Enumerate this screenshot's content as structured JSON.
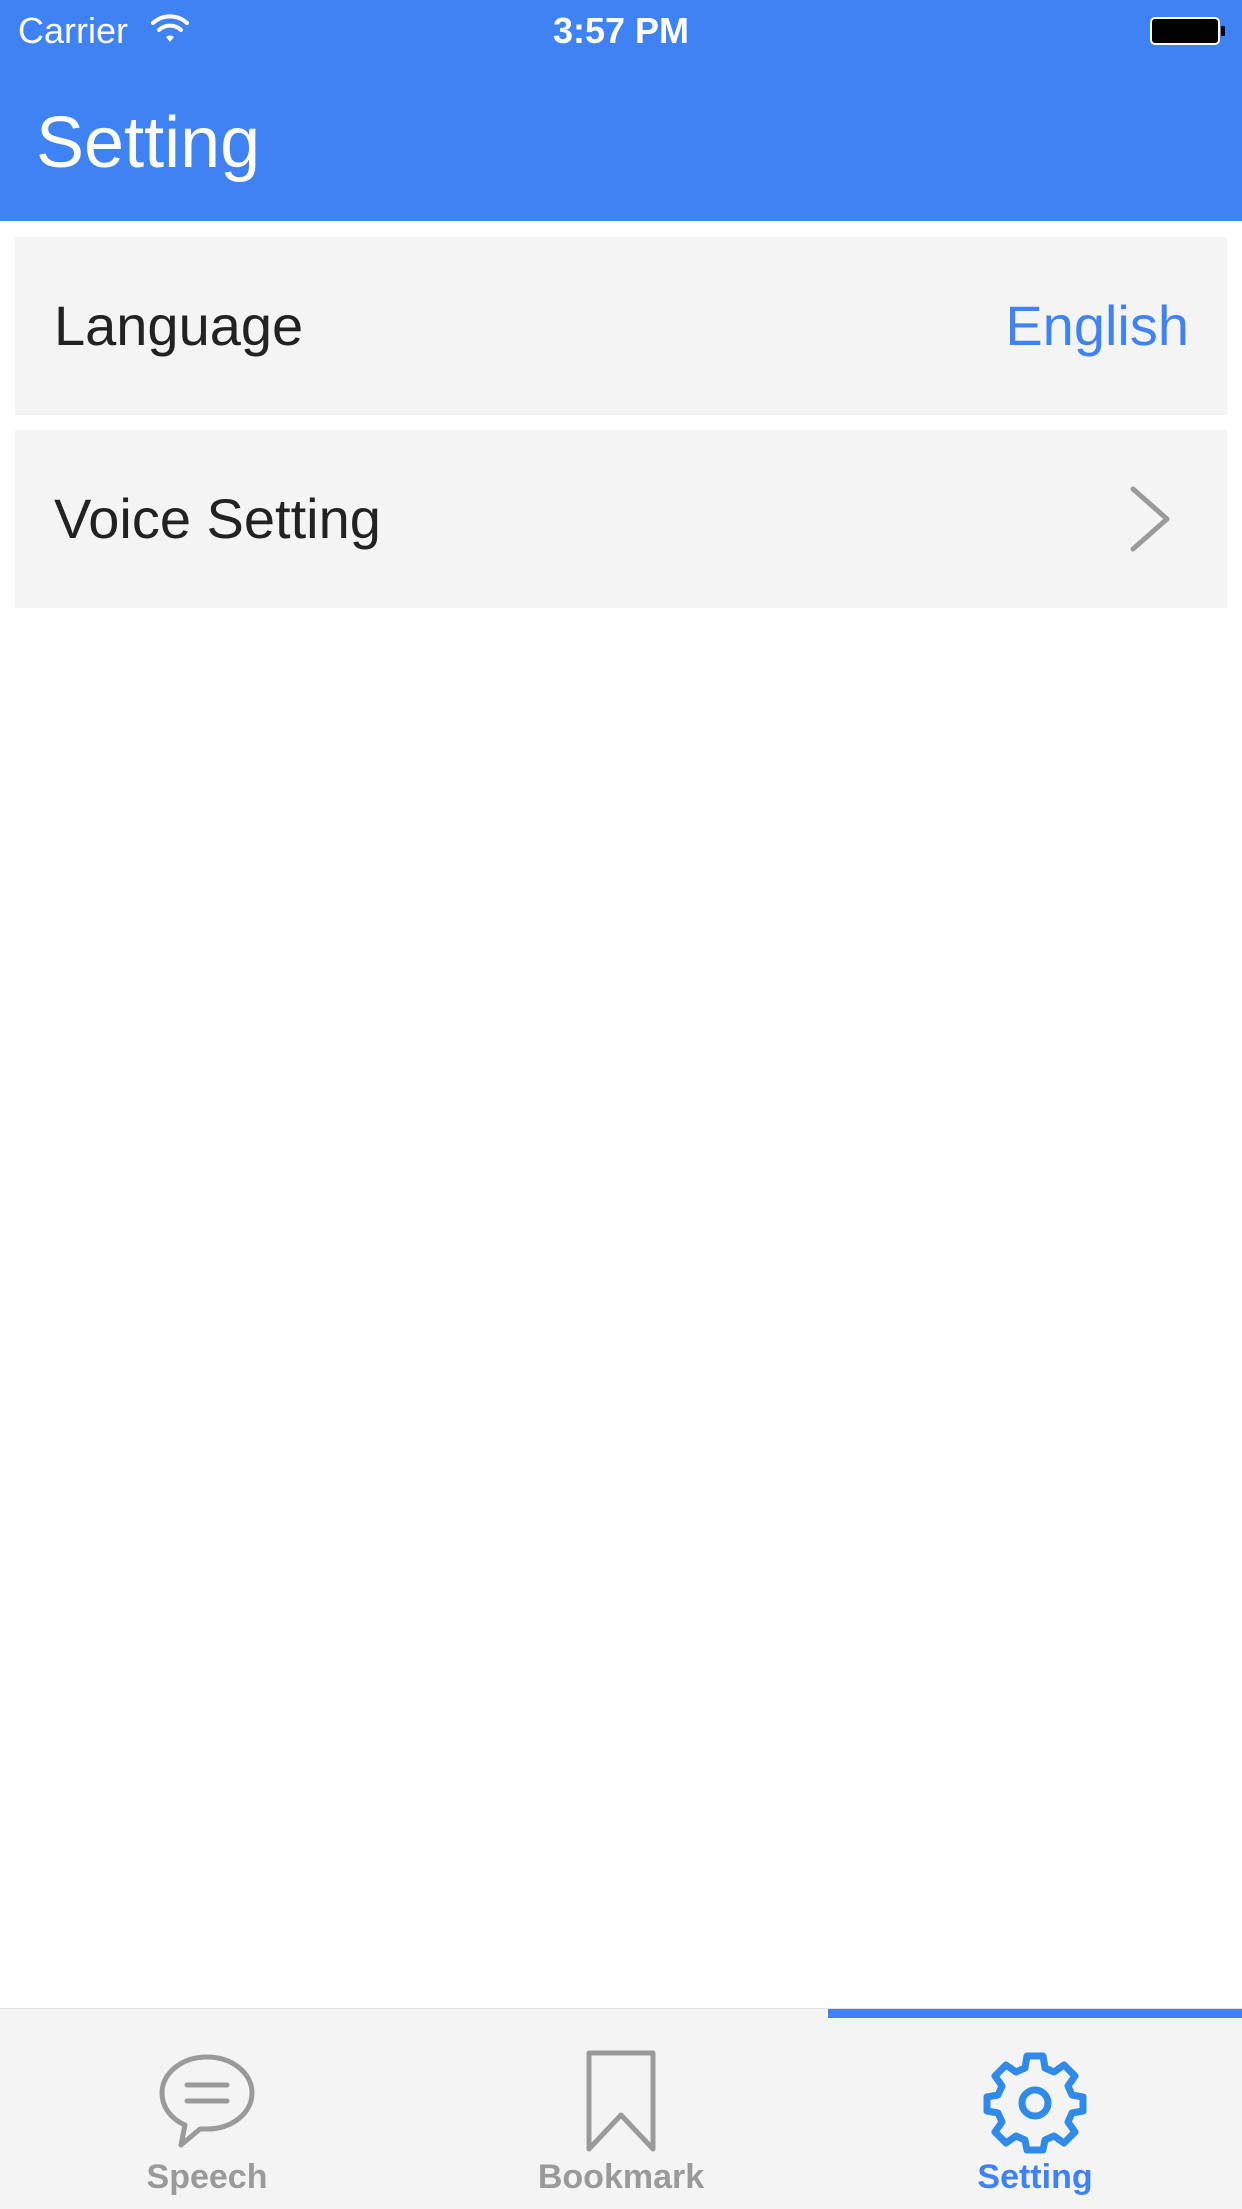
{
  "status_bar": {
    "carrier": "Carrier",
    "time": "3:57 PM",
    "icons": [
      "wifi-icon",
      "battery-icon"
    ]
  },
  "header": {
    "title": "Setting",
    "background_color": "#3f82f4"
  },
  "settings": {
    "rows": [
      {
        "label": "Language",
        "value": "English",
        "accessory": "value"
      },
      {
        "label": "Voice Setting",
        "accessory": "chevron-right-icon"
      }
    ]
  },
  "tab_bar": {
    "tabs": [
      {
        "label": "Speech",
        "icon": "speech-bubble-icon",
        "selected": false
      },
      {
        "label": "Bookmark",
        "icon": "bookmark-icon",
        "selected": false
      },
      {
        "label": "Setting",
        "icon": "gear-icon",
        "selected": true
      }
    ],
    "active_color": "#3f82f4",
    "inactive_color": "#9a9a9a"
  }
}
